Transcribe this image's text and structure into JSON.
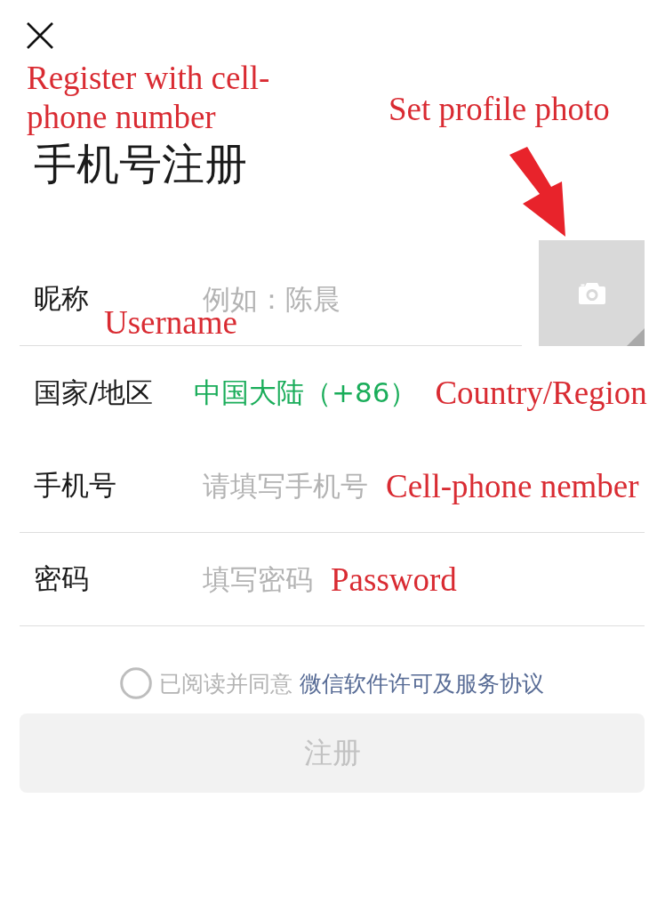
{
  "header": {
    "annotation": "Register with cell-phone number",
    "title": "手机号注册"
  },
  "avatar": {
    "annotation": "Set profile photo"
  },
  "fields": [
    {
      "kind": "input",
      "label": "昵称",
      "placeholder": "例如：陈晨",
      "annotation": "Username"
    },
    {
      "kind": "select",
      "label": "国家/地区",
      "value": "中国大陆（+86）",
      "annotation": "Country/Region"
    },
    {
      "kind": "input",
      "label": "手机号",
      "placeholder": "请填写手机号",
      "annotation": "Cell-phone nember"
    },
    {
      "kind": "input",
      "label": "密码",
      "placeholder": "填写密码",
      "annotation": "Password"
    }
  ],
  "agreement": {
    "checked": false,
    "text": "已阅读并同意",
    "link": "微信软件许可及服务协议"
  },
  "submit_button": {
    "label": "注册",
    "disabled": true
  }
}
